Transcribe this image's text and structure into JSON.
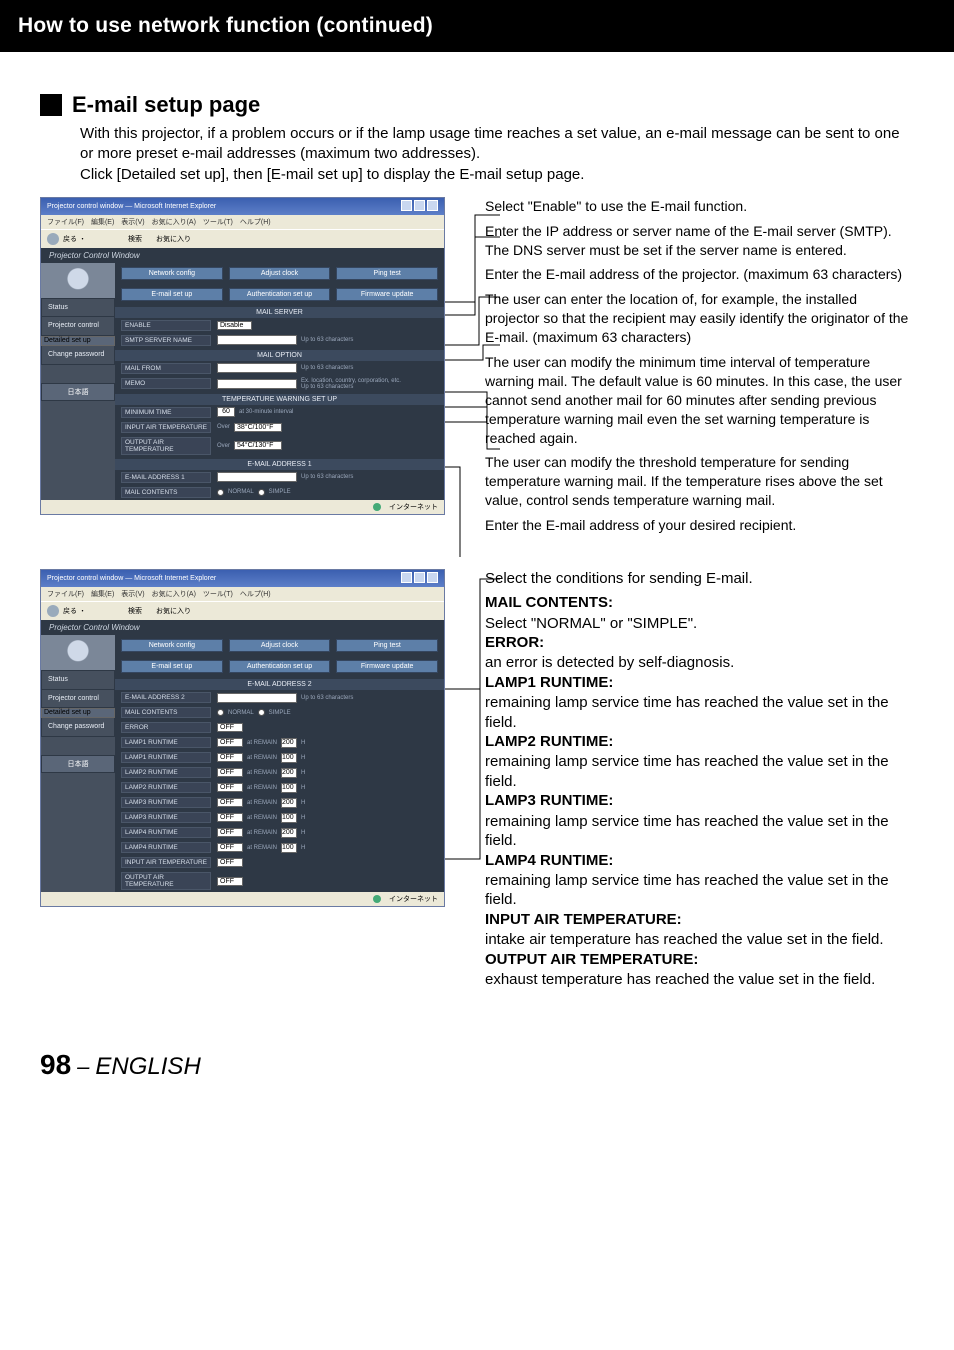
{
  "header": {
    "title": "How to use network function (continued)"
  },
  "section": {
    "title": "E-mail setup page",
    "intro": "With this projector, if a problem occurs or if the lamp usage time reaches a set value, an e-mail message can be sent to one or more preset e-mail addresses (maximum two addresses).\nClick [Detailed set up], then [E-mail set up] to display the E-mail setup page."
  },
  "browser": {
    "title": "Projector control window — Microsoft Internet Explorer",
    "menubar": "ファイル(F)　編集(E)　表示(V)　お気に入り(A)　ツール(T)　ヘルプ(H)",
    "toolbar_text": "戻る ・　　　　　　検索　　お気に入り",
    "app_title": "Projector Control Window",
    "tabs_top": [
      "Network config",
      "Adjust clock",
      "Ping test"
    ],
    "tabs_bottom": [
      "E-mail set up",
      "Authentication set up",
      "Firmware update"
    ],
    "sidebar": {
      "items": [
        "Status",
        "Projector control",
        "Detailed set up",
        "Change password"
      ],
      "lang": "日本語"
    },
    "panel1": {
      "h1": "MAIL SERVER",
      "r1_label": "ENABLE",
      "r1_value": "Disable",
      "r2_label": "SMTP SERVER NAME",
      "r2_hint": "Up to 63 characters",
      "h2": "MAIL OPTION",
      "r3_label": "MAIL FROM",
      "r3_hint": "Up to 63 characters",
      "r4_label": "MEMO",
      "r4_hint": "Ex. location, country, corporation, etc.\nUp to 63 characters",
      "h3": "TEMPERATURE WARNING SET UP",
      "r5_label": "MINIMUM TIME",
      "r5_value": "60",
      "r5_unit": "at 30-minute interval",
      "r6_label": "INPUT AIR TEMPERATURE",
      "r6_a": "Over",
      "r6_b": "38°C/100°F",
      "r7_label": "OUTPUT AIR TEMPERATURE",
      "r7_a": "Over",
      "r7_b": "54°C/130°F",
      "h4": "E-MAIL ADDRESS 1",
      "r8_label": "E-MAIL ADDRESS 1",
      "r8_hint": "Up to 63 characters",
      "r9_label": "MAIL CONTENTS",
      "r9_opt1": "NORMAL",
      "r9_opt2": "SIMPLE"
    },
    "status": "インターネット"
  },
  "callouts": [
    "Select \"Enable\" to use the E-mail function.",
    "Enter the IP address or server name of the E-mail server (SMTP). The DNS server must be set if the server name is entered.",
    "Enter the E-mail address of the projector. (maximum 63 characters)",
    "The user can enter the location of, for example, the installed projector so that the recipient may easily identify the originator of the E-mail. (maximum 63 characters)",
    "The user can modify the minimum time interval of temperature warning mail. The default value is 60 minutes.  In this case, the user cannot send another mail for 60 minutes after sending previous temperature warning mail even the set warning temperature is reached again.",
    "The user can modify the threshold temperature for sending temperature warning mail. If the temperature rises above the set value, control sends temperature warning mail.",
    "Enter the E-mail address of your desired recipient."
  ],
  "browser2": {
    "panel2": {
      "h1": "E-MAIL ADDRESS 2",
      "r1_label": "E-MAIL ADDRESS 2",
      "r1_hint": "Up to 63 characters",
      "r2_label": "MAIL CONTENTS",
      "r2_opt1": "NORMAL",
      "r2_opt2": "SIMPLE",
      "r3_label": "ERROR",
      "r3_value": "OFF",
      "lamp1_label": "LAMP1 RUNTIME",
      "lamp1_val": "OFF",
      "lamp1_at": "at REMAIN",
      "lamp1_h": "200",
      "lamp1_u": "H",
      "lamp1b_label": "LAMP1 RUNTIME",
      "lamp1b_val": "OFF",
      "lamp1b_at": "at REMAIN",
      "lamp1b_h": "100",
      "lamp1b_u": "H",
      "lamp2_label": "LAMP2 RUNTIME",
      "lamp2_val": "OFF",
      "lamp2_at": "at REMAIN",
      "lamp2_h": "200",
      "lamp2_u": "H",
      "lamp2b_label": "LAMP2 RUNTIME",
      "lamp2b_val": "OFF",
      "lamp2b_at": "at REMAIN",
      "lamp2b_h": "100",
      "lamp2b_u": "H",
      "lamp3_label": "LAMP3 RUNTIME",
      "lamp3_val": "OFF",
      "lamp3_at": "at REMAIN",
      "lamp3_h": "200",
      "lamp3_u": "H",
      "lamp3b_label": "LAMP3 RUNTIME",
      "lamp3b_val": "OFF",
      "lamp3b_at": "at REMAIN",
      "lamp3b_h": "100",
      "lamp3b_u": "H",
      "lamp4_label": "LAMP4 RUNTIME",
      "lamp4_val": "OFF",
      "lamp4_at": "at REMAIN",
      "lamp4_h": "200",
      "lamp4_u": "H",
      "lamp4b_label": "LAMP4 RUNTIME",
      "lamp4b_val": "OFF",
      "lamp4b_at": "at REMAIN",
      "lamp4b_h": "100",
      "lamp4b_u": "H",
      "in_label": "INPUT AIR TEMPERATURE",
      "in_val": "OFF",
      "out_label": "OUTPUT AIR TEMPERATURE",
      "out_val": "OFF"
    }
  },
  "conditions": {
    "intro": "Select the conditions for sending E-mail.",
    "items": [
      {
        "h": "MAIL CONTENTS:",
        "b": "Select \"NORMAL\" or \"SIMPLE\"."
      },
      {
        "h": "ERROR:",
        "b": "an error is detected by self-diagnosis."
      },
      {
        "h": "LAMP1 RUNTIME:",
        "b": "remaining lamp service time has reached the value set in the field."
      },
      {
        "h": "LAMP2 RUNTIME:",
        "b": "remaining lamp service time has reached the value set in the field."
      },
      {
        "h": "LAMP3 RUNTIME:",
        "b": "remaining lamp service time has reached the value set in the field."
      },
      {
        "h": "LAMP4 RUNTIME:",
        "b": "remaining lamp service time has reached the value set in the field."
      },
      {
        "h": "INPUT AIR TEMPERATURE:",
        "b": "intake air temperature has reached the value set in the field."
      },
      {
        "h": "OUTPUT AIR TEMPERATURE:",
        "b": "exhaust temperature has reached the value set in the field."
      }
    ]
  },
  "footer": {
    "page": "98",
    "dash": "–",
    "lang": "ENGLISH"
  }
}
